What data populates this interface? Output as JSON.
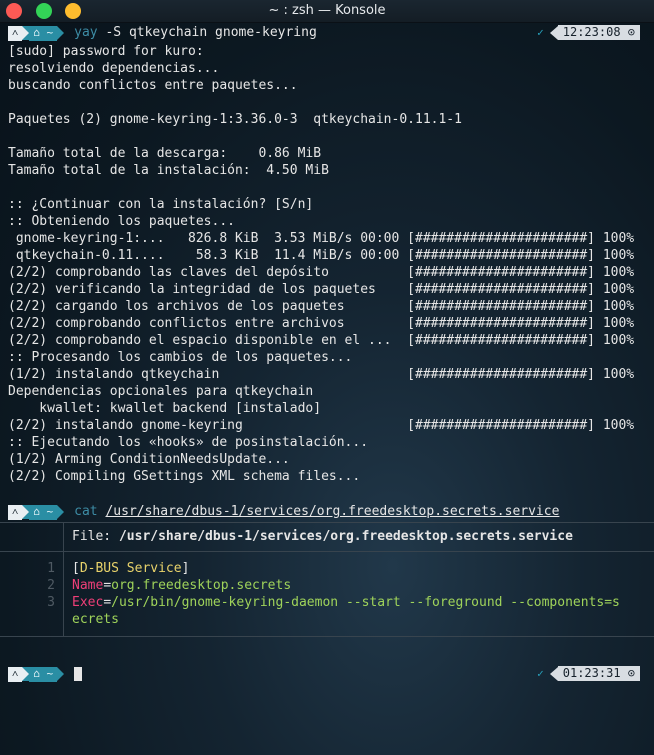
{
  "window": {
    "title": "~ : zsh — Konsole"
  },
  "prompt1": {
    "arch_icon": "arch-icon",
    "home_glyph": "⌂ ~",
    "bin": "yay",
    "args": " -S qtkeychain gnome-keyring",
    "check": "✓",
    "time": "12:23:08 ⊙"
  },
  "output": [
    "[sudo] password for kuro:",
    "resolviendo dependencias...",
    "buscando conflictos entre paquetes...",
    "",
    "Paquetes (2) gnome-keyring-1:3.36.0-3  qtkeychain-0.11.1-1",
    "",
    "Tamaño total de la descarga:    0.86 MiB",
    "Tamaño total de la instalación:  4.50 MiB",
    "",
    ":: ¿Continuar con la instalación? [S/n]",
    ":: Obteniendo los paquetes...",
    " gnome-keyring-1:...   826.8 KiB  3.53 MiB/s 00:00 [######################] 100%",
    " qtkeychain-0.11....    58.3 KiB  11.4 MiB/s 00:00 [######################] 100%",
    "(2/2) comprobando las claves del depósito          [######################] 100%",
    "(2/2) verificando la integridad de los paquetes    [######################] 100%",
    "(2/2) cargando los archivos de los paquetes        [######################] 100%",
    "(2/2) comprobando conflictos entre archivos        [######################] 100%",
    "(2/2) comprobando el espacio disponible en el ...  [######################] 100%",
    ":: Procesando los cambios de los paquetes...",
    "(1/2) instalando qtkeychain                        [######################] 100%",
    "Dependencias opcionales para qtkeychain",
    "    kwallet: kwallet backend [instalado]",
    "(2/2) instalando gnome-keyring                     [######################] 100%",
    ":: Ejecutando los «hooks» de posinstalación...",
    "(1/2) Arming ConditionNeedsUpdate...",
    "(2/2) Compiling GSettings XML schema files..."
  ],
  "prompt2": {
    "home_glyph": "⌂ ~",
    "bin": "cat",
    "path": "/usr/share/dbus-1/services/org.freedesktop.secrets.service"
  },
  "bat": {
    "file_label": "File: ",
    "file_path": "/usr/share/dbus-1/services/org.freedesktop.secrets.service",
    "lines": [
      {
        "num": "1",
        "parts": [
          {
            "t": "[",
            "c": "k-white"
          },
          {
            "t": "D-BUS Service",
            "c": "k-yellow"
          },
          {
            "t": "]",
            "c": "k-white"
          }
        ]
      },
      {
        "num": "2",
        "parts": [
          {
            "t": "Name",
            "c": "k-pink"
          },
          {
            "t": "=",
            "c": "k-white"
          },
          {
            "t": "org.freedesktop.secrets",
            "c": "k-green"
          }
        ]
      },
      {
        "num": "3",
        "parts": [
          {
            "t": "Exec",
            "c": "k-pink"
          },
          {
            "t": "=",
            "c": "k-white"
          },
          {
            "t": "/usr/bin/gnome-keyring-daemon --start --foreground --components=s",
            "c": "k-green"
          }
        ]
      },
      {
        "num": "",
        "parts": [
          {
            "t": "ecrets",
            "c": "k-green"
          }
        ]
      }
    ]
  },
  "prompt3": {
    "home_glyph": "⌂ ~",
    "check": "✓",
    "time": "01:23:31 ⊙"
  },
  "colors": {
    "background": "#0c1821",
    "segment_home": "#2a8ea4",
    "segment_arch": "#e9eef2",
    "command_bin": "#3d8ca5"
  }
}
